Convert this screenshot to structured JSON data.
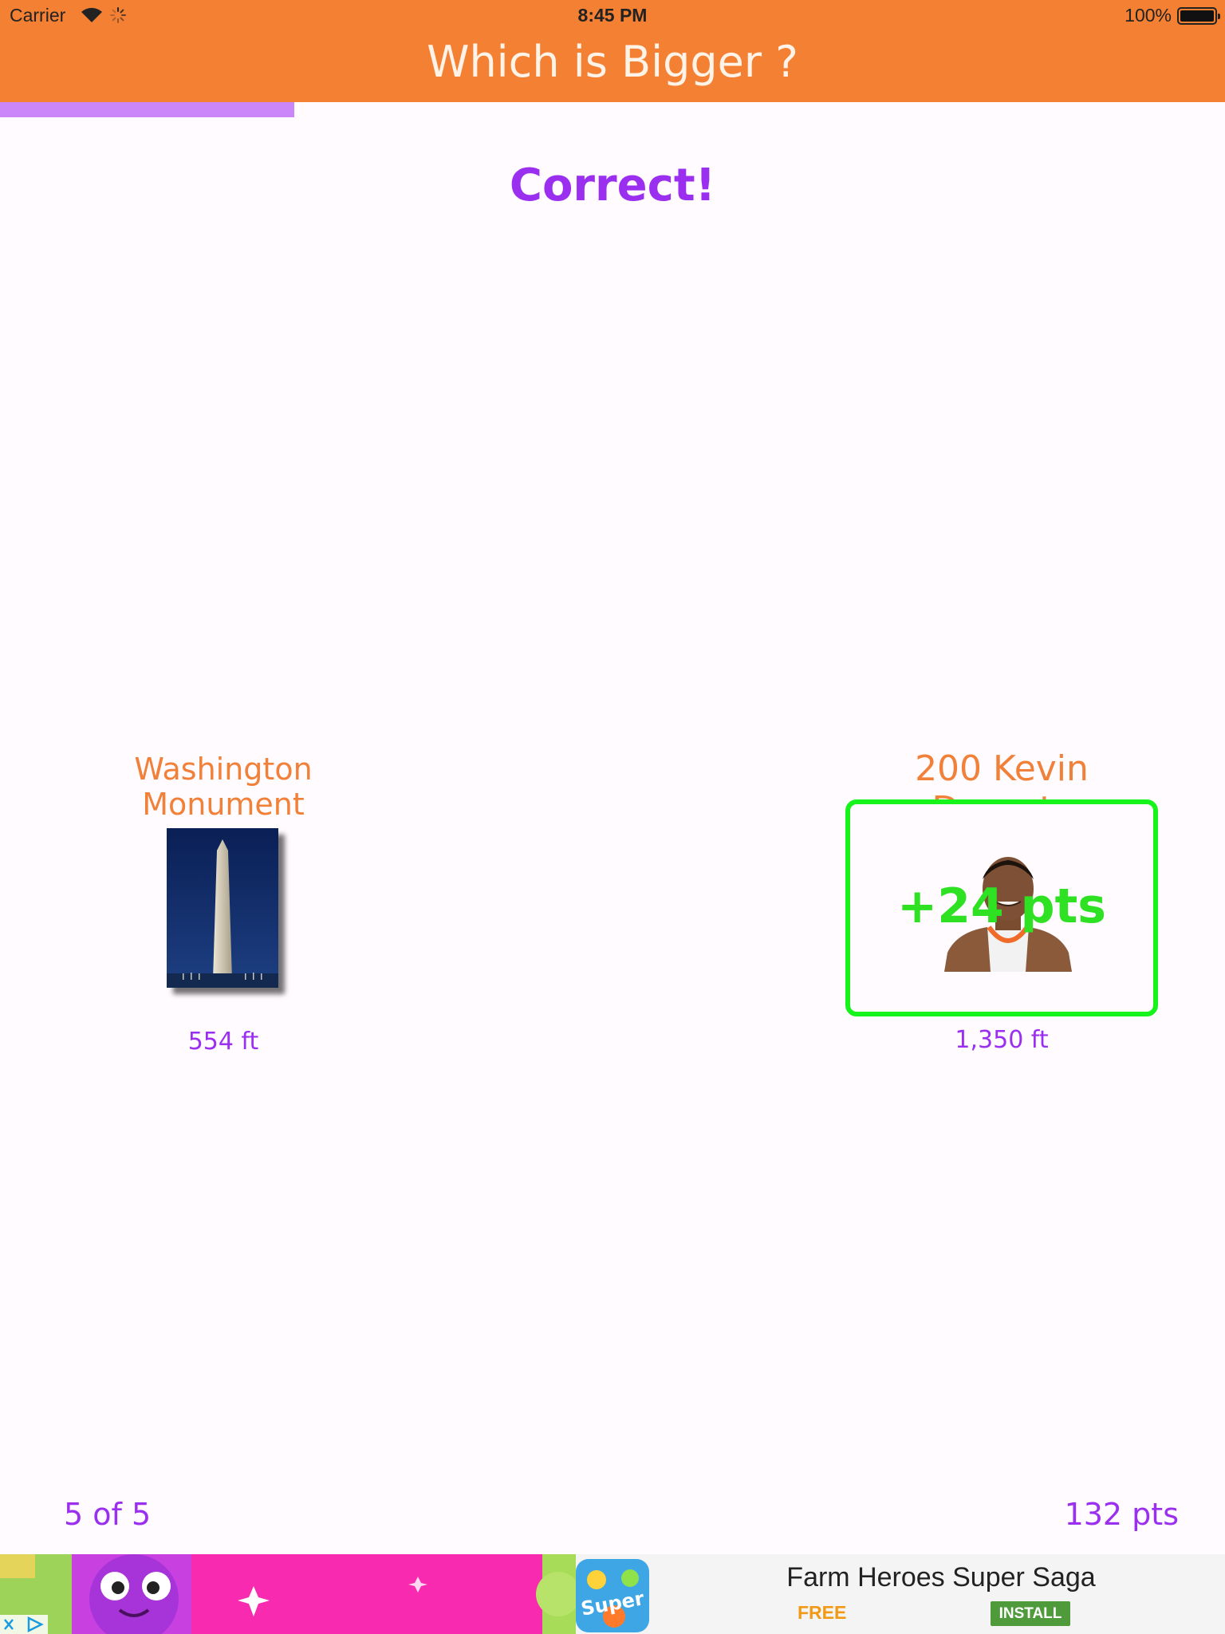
{
  "status_bar": {
    "carrier": "Carrier",
    "time": "8:45 PM",
    "battery": "100%"
  },
  "header": {
    "title": "Which is Bigger ?"
  },
  "progress": {
    "fraction": 0.24
  },
  "result": {
    "text": "Correct!"
  },
  "left_item": {
    "name": "Washington Monument",
    "value": "554 ft"
  },
  "right_item": {
    "name": "200 Kevin Durants",
    "value": "1,350 ft",
    "bonus": "+24 pts"
  },
  "footer": {
    "counter": "5 of 5",
    "score": "132 pts"
  },
  "ad": {
    "title": "Farm Heroes Super Saga",
    "price": "FREE",
    "install": "INSTALL",
    "icon_text": "Super"
  },
  "colors": {
    "header": "#f48033",
    "accent": "#9b2ff0",
    "item_label": "#f18038",
    "correct": "#16f41c",
    "progress": "#cb86f9"
  }
}
